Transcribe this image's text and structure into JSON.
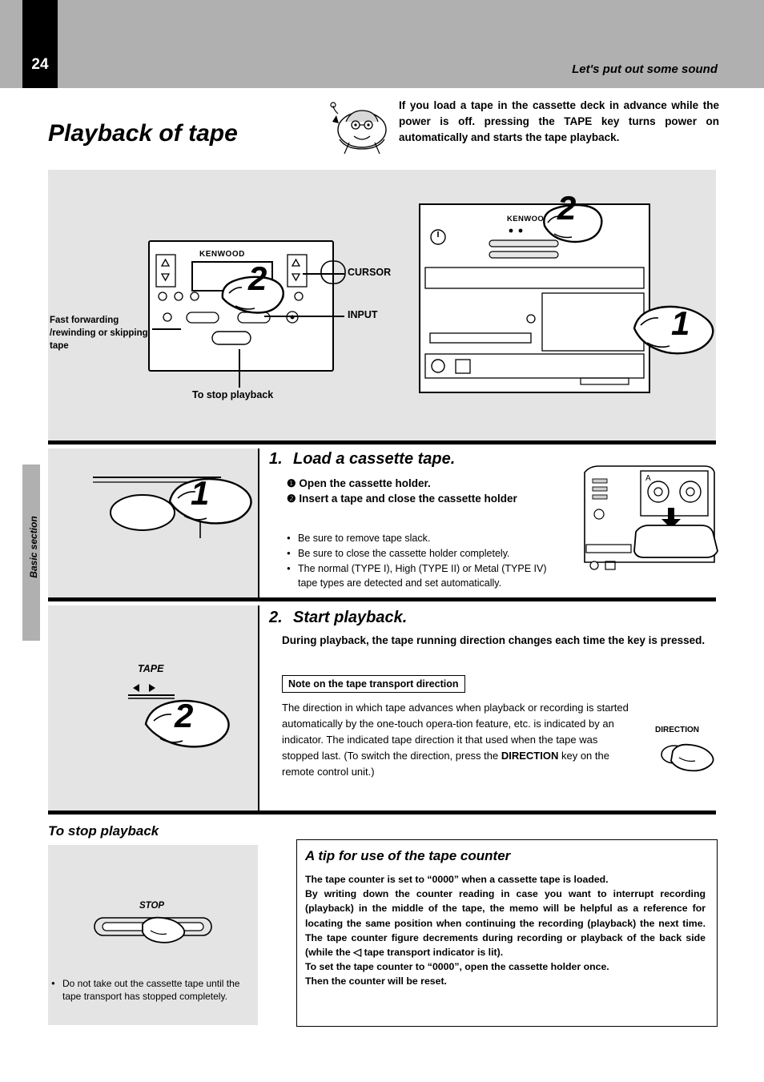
{
  "header": {
    "page_number": "24",
    "section_title": "Let's put out some sound",
    "side_tab": "Basic section"
  },
  "title": "Playback of tape",
  "intro": "If you load a tape in the cassette deck in advance while the power is off. pressing the TAPE key turns power on automatically and starts the tape playback.",
  "diagram": {
    "cursor_label": "CURSOR",
    "input_label": "INPUT",
    "fast_forward_label": "Fast forwarding /rewinding or skipping tape",
    "stop_label": "To stop playback",
    "brand": "KENWOOD",
    "callout_1": "1",
    "callout_2": "2"
  },
  "step1": {
    "number": "1.",
    "title": "Load a cassette tape.",
    "sub1": "Open the cassette holder.",
    "sub2": "Insert a tape and close the cassette holder",
    "bullets": [
      "Be sure to remove tape slack.",
      "Be sure to close the cassette holder completely.",
      "The normal (TYPE I), High (TYPE II) or Metal (TYPE IV) tape types are detected and set automatically."
    ],
    "callout": "1",
    "deck_letter": "A"
  },
  "step2": {
    "number": "2.",
    "title": "Start playback.",
    "lead": "During playback, the tape running direction changes each time the key is pressed.",
    "note_box": "Note on the tape transport direction",
    "paragraph_part1": "The direction in which tape advances when playback or recording is started automatically by the one-touch opera-tion feature, etc. is indicated by an indicator. The indicated tape direction it that used when the tape was stopped last. (To switch the direction, press the ",
    "paragraph_key": "DIRECTION",
    "paragraph_part2": " key on the remote control unit.)",
    "key_label": "TAPE",
    "direction_label": "DIRECTION",
    "callout": "2"
  },
  "bottom": {
    "stop_title": "To stop playback",
    "stop_key_label": "STOP",
    "stop_note": "Do not take out the cassette tape until the tape transport has stopped completely.",
    "tip_title": "A tip for use of the tape counter",
    "tip_line1": "The tape counter is set to “0000” when a cassette tape is loaded.",
    "tip_line2": "By writing down the counter reading in case you want to interrupt recording (playback) in the middle of the tape, the memo will be helpful as a reference for locating the same position when continuing the recording (playback) the next time. The tape counter figure decrements during recording or playback of the back side (while the",
    "tip_line2b": "tape transport indicator is lit).",
    "tip_line3": "To set the tape counter to “0000”, open the cassette holder once.",
    "tip_line4": "Then the counter will be reset."
  },
  "colors": {
    "header_gray": "#b0b0b0",
    "panel_gray": "#e4e4e4",
    "ink": "#000000"
  }
}
